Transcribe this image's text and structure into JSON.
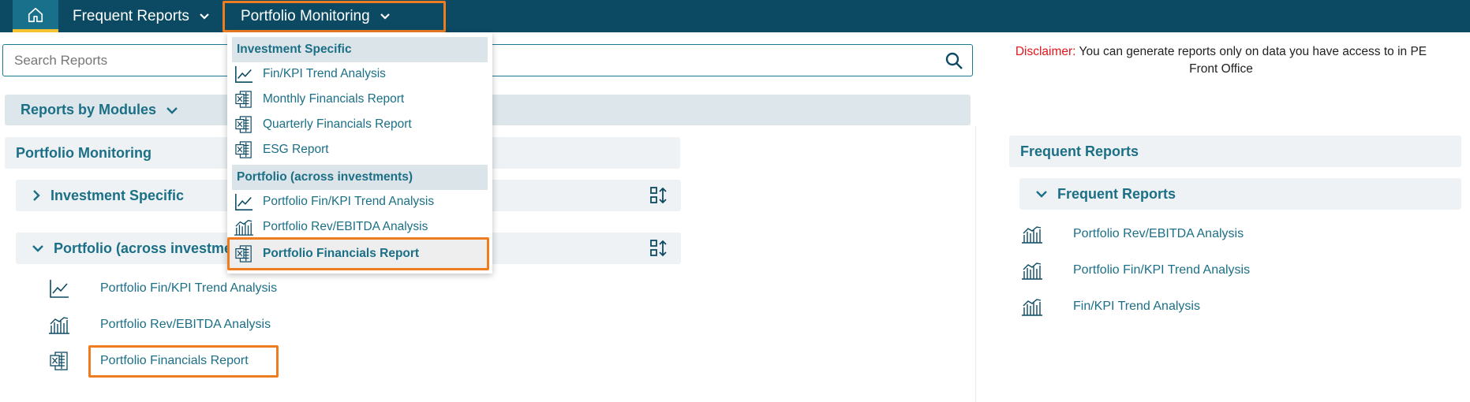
{
  "topnav": {
    "frequent_label": "Frequent Reports",
    "portfolio_label": "Portfolio Monitoring"
  },
  "search": {
    "placeholder": "Search Reports"
  },
  "disclaimer": {
    "label": "Disclaimer:",
    "text": "You can generate reports only on data you have access to in PE Front Office"
  },
  "modules": {
    "title": "Reports by Modules",
    "section_title": "Portfolio Monitoring",
    "groups": [
      {
        "label": "Investment Specific",
        "expanded": false
      },
      {
        "label": "Portfolio (across investments)",
        "expanded": true
      }
    ],
    "portfolio_reports": [
      {
        "label": "Portfolio Fin/KPI Trend Analysis",
        "icon": "line-chart-icon"
      },
      {
        "label": "Portfolio Rev/EBITDA Analysis",
        "icon": "bar-chart-icon"
      },
      {
        "label": "Portfolio Financials Report",
        "icon": "excel-icon"
      }
    ]
  },
  "frequent": {
    "section_title": "Frequent Reports",
    "group_label": "Frequent Reports",
    "items": [
      {
        "label": "Portfolio Rev/EBITDA Analysis",
        "icon": "bar-chart-icon"
      },
      {
        "label": "Portfolio Fin/KPI Trend Analysis",
        "icon": "bar-chart-icon"
      },
      {
        "label": "Fin/KPI Trend Analysis",
        "icon": "bar-chart-icon"
      }
    ]
  },
  "dropdown": {
    "headers": [
      "Investment Specific",
      "Portfolio (across investments)"
    ],
    "items": [
      {
        "label": "Fin/KPI Trend Analysis",
        "icon": "line-chart-icon"
      },
      {
        "label": "Monthly Financials Report",
        "icon": "excel-icon"
      },
      {
        "label": "Quarterly Financials Report",
        "icon": "excel-icon"
      },
      {
        "label": "ESG Report",
        "icon": "excel-icon"
      },
      {
        "label": "Portfolio Fin/KPI Trend Analysis",
        "icon": "line-chart-icon"
      },
      {
        "label": "Portfolio Rev/EBITDA Analysis",
        "icon": "bar-chart-icon"
      },
      {
        "label": "Portfolio Financials Report",
        "icon": "excel-icon"
      }
    ],
    "selected_label": "Portfolio Financials Report"
  },
  "colors": {
    "nav_bg": "#0c4a64",
    "accent_teal": "#1b6f86",
    "highlight_orange": "#ef7d20",
    "home_underline": "#f2c230",
    "disclaimer_red": "#e1151b"
  }
}
